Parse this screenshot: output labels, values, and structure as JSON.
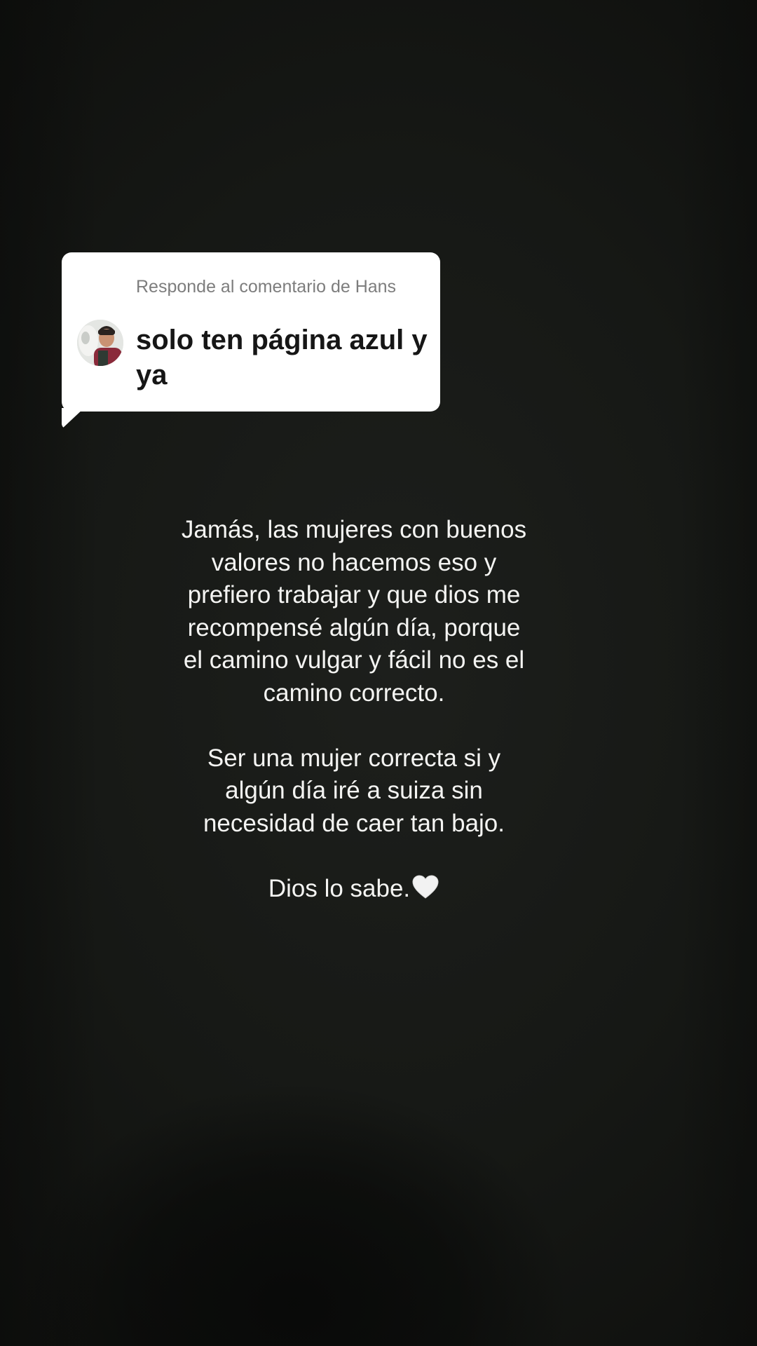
{
  "reply": {
    "header": "Responde al comentario de Hans",
    "comment": "solo ten página azul y ya",
    "avatar_icon": "user-avatar-photo"
  },
  "caption": {
    "paragraph_1": "Jamás, las mujeres con buenos valores no hacemos eso y prefiero trabajar y que dios me recompensé algún día, porque el camino vulgar y fácil no es el camino correcto.",
    "paragraph_2": "Ser una mujer correcta si y algún día iré a suiza sin necesidad de caer tan bajo.",
    "paragraph_3": "Dios lo sabe.",
    "heart_icon": "white-heart-icon"
  },
  "colors": {
    "background": "#161815",
    "card": "#ffffff",
    "caption_text": "#f4f4f2",
    "reply_header": "#7d7d7d",
    "reply_text": "#161616"
  }
}
